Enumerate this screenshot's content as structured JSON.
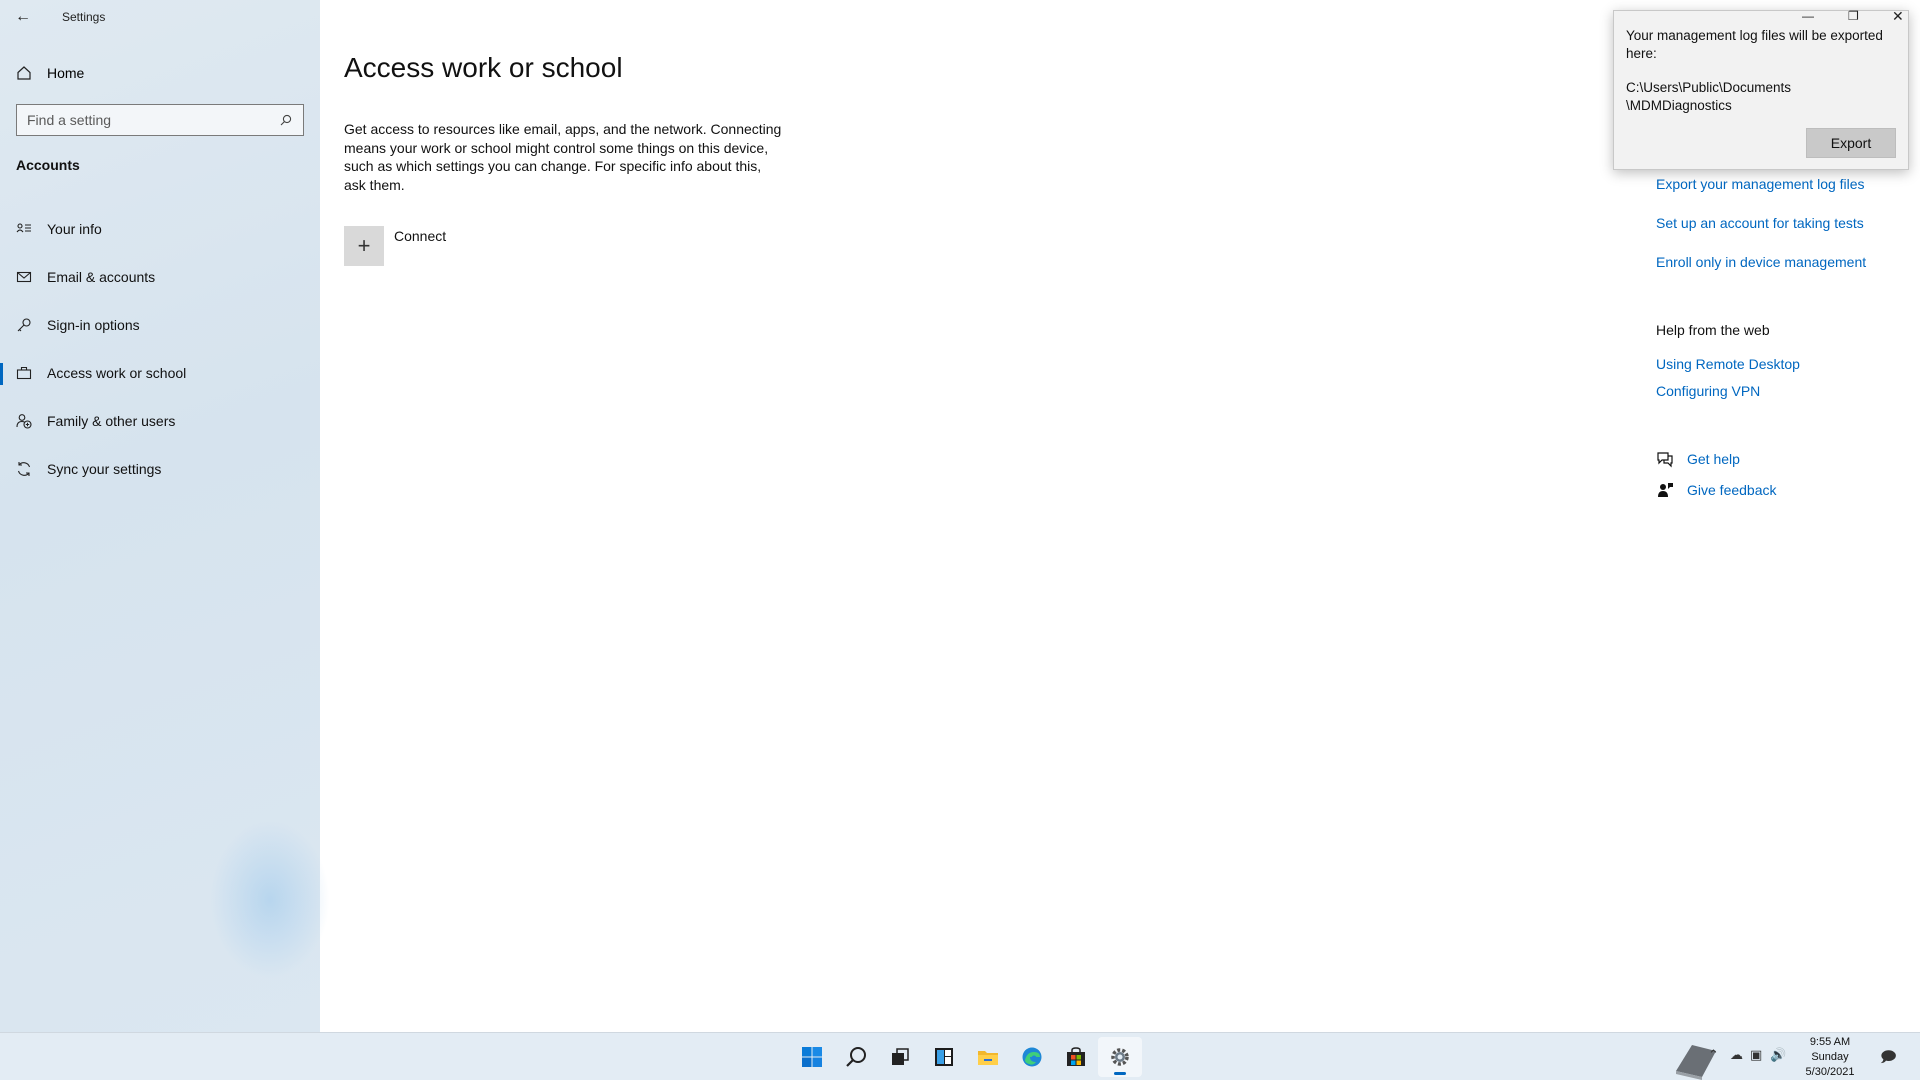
{
  "window": {
    "title": "Settings"
  },
  "sidebar": {
    "home_label": "Home",
    "search_placeholder": "Find a setting",
    "section_title": "Accounts",
    "items": [
      {
        "label": "Your info",
        "icon": "person-card-icon"
      },
      {
        "label": "Email & accounts",
        "icon": "mail-icon"
      },
      {
        "label": "Sign-in options",
        "icon": "key-icon"
      },
      {
        "label": "Access work or school",
        "icon": "briefcase-icon",
        "selected": true
      },
      {
        "label": "Family & other users",
        "icon": "people-add-icon"
      },
      {
        "label": "Sync your settings",
        "icon": "sync-icon"
      }
    ]
  },
  "main": {
    "title": "Access work or school",
    "description": "Get access to resources like email, apps, and the network. Connecting means your work or school might control some things on this device, such as which settings you can change. For specific info about this, ask them.",
    "connect_label": "Connect"
  },
  "related": {
    "links": [
      "Export your management log files",
      "Set up an account for taking tests",
      "Enroll only in device management"
    ],
    "help_heading": "Help from the web",
    "help_links": [
      "Using Remote Desktop",
      "Configuring VPN"
    ],
    "get_help": "Get help",
    "give_feedback": "Give feedback"
  },
  "popup": {
    "message": "Your management log files will be exported here:",
    "path_line1": "C:\\Users\\Public\\Documents",
    "path_line2": "\\MDMDiagnostics",
    "export_label": "Export"
  },
  "taskbar": {
    "apps": [
      "start-icon",
      "search-icon",
      "task-view-icon",
      "widgets-icon",
      "file-explorer-icon",
      "edge-icon",
      "store-icon",
      "settings-icon"
    ],
    "time": "9:55 AM",
    "day": "Sunday",
    "date": "5/30/2021"
  }
}
